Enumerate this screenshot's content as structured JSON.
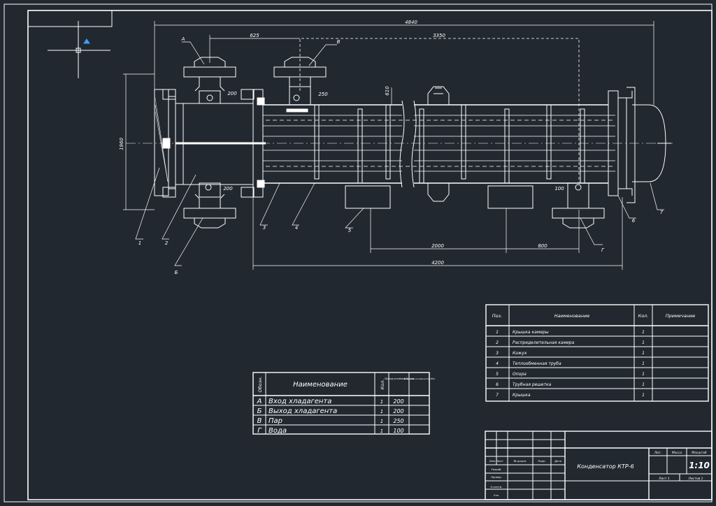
{
  "drawing": {
    "dimensions": {
      "overall_length": "4840",
      "nozzle_offset": "625",
      "nozzle_span": "3350",
      "shell_height": "1960",
      "shell_diameter": "610",
      "nozzle_dia_200_upper": "200",
      "nozzle_dia_250": "250",
      "nozzle_dia_200_lower": "200",
      "nozzle_dia_200_lower2": "200",
      "nozzle_dia_100": "100",
      "support_span": "2000",
      "support_offset": "800",
      "bottom_length": "4200"
    },
    "callouts": {
      "A": "А",
      "B": "Б",
      "V": "В",
      "G": "Г",
      "n1": "1",
      "n2": "2",
      "n3": "3",
      "n4": "4",
      "n5": "5",
      "n6": "6",
      "n7": "7"
    }
  },
  "parts_table": {
    "headers": {
      "pos": "Поз.",
      "name": "Наименование",
      "qty": "Кол.",
      "note": "Примечание"
    },
    "rows": [
      {
        "pos": "1",
        "name": "Крышка камеры",
        "qty": "1"
      },
      {
        "pos": "2",
        "name": "Распределительная камера",
        "qty": "1"
      },
      {
        "pos": "3",
        "name": "Кожух",
        "qty": "1"
      },
      {
        "pos": "4",
        "name": "Теплообменная труба",
        "qty": "1"
      },
      {
        "pos": "5",
        "name": "Опора",
        "qty": "1"
      },
      {
        "pos": "6",
        "name": "Трубная решетка",
        "qty": "1"
      },
      {
        "pos": "7",
        "name": "Крышка",
        "qty": "1"
      }
    ]
  },
  "nozzle_table": {
    "headers": {
      "mark": "Обозн.",
      "name": "Наименование",
      "qty": "Кол.",
      "dn": "Проход условный Dу, мм",
      "pressure": "Давление условное Pу, МПа"
    },
    "rows": [
      {
        "mark": "А",
        "name": "Вход хладагента",
        "qty": "1",
        "dn": "200"
      },
      {
        "mark": "Б",
        "name": "Выход хладагента",
        "qty": "1",
        "dn": "200"
      },
      {
        "mark": "В",
        "name": "Пар",
        "qty": "1",
        "dn": "250"
      },
      {
        "mark": "Г",
        "name": "Вода",
        "qty": "1",
        "dn": "100"
      }
    ]
  },
  "title_block": {
    "title": "Конденсатор КТР-6",
    "scale": "1:10",
    "col_lit": "Лит.",
    "col_mass": "Масса",
    "col_scale": "Масштаб",
    "sheet": "Лист 1",
    "sheets": "Листов 1",
    "row_izm": "Изм. Лист",
    "row_doc": "№ докум.",
    "row_sign": "Подп.",
    "row_date": "Дата",
    "row_razrab": "Разраб.",
    "row_prov": "Провер.",
    "row_nkontr": "Н.контр.",
    "row_utv": "Утв."
  }
}
